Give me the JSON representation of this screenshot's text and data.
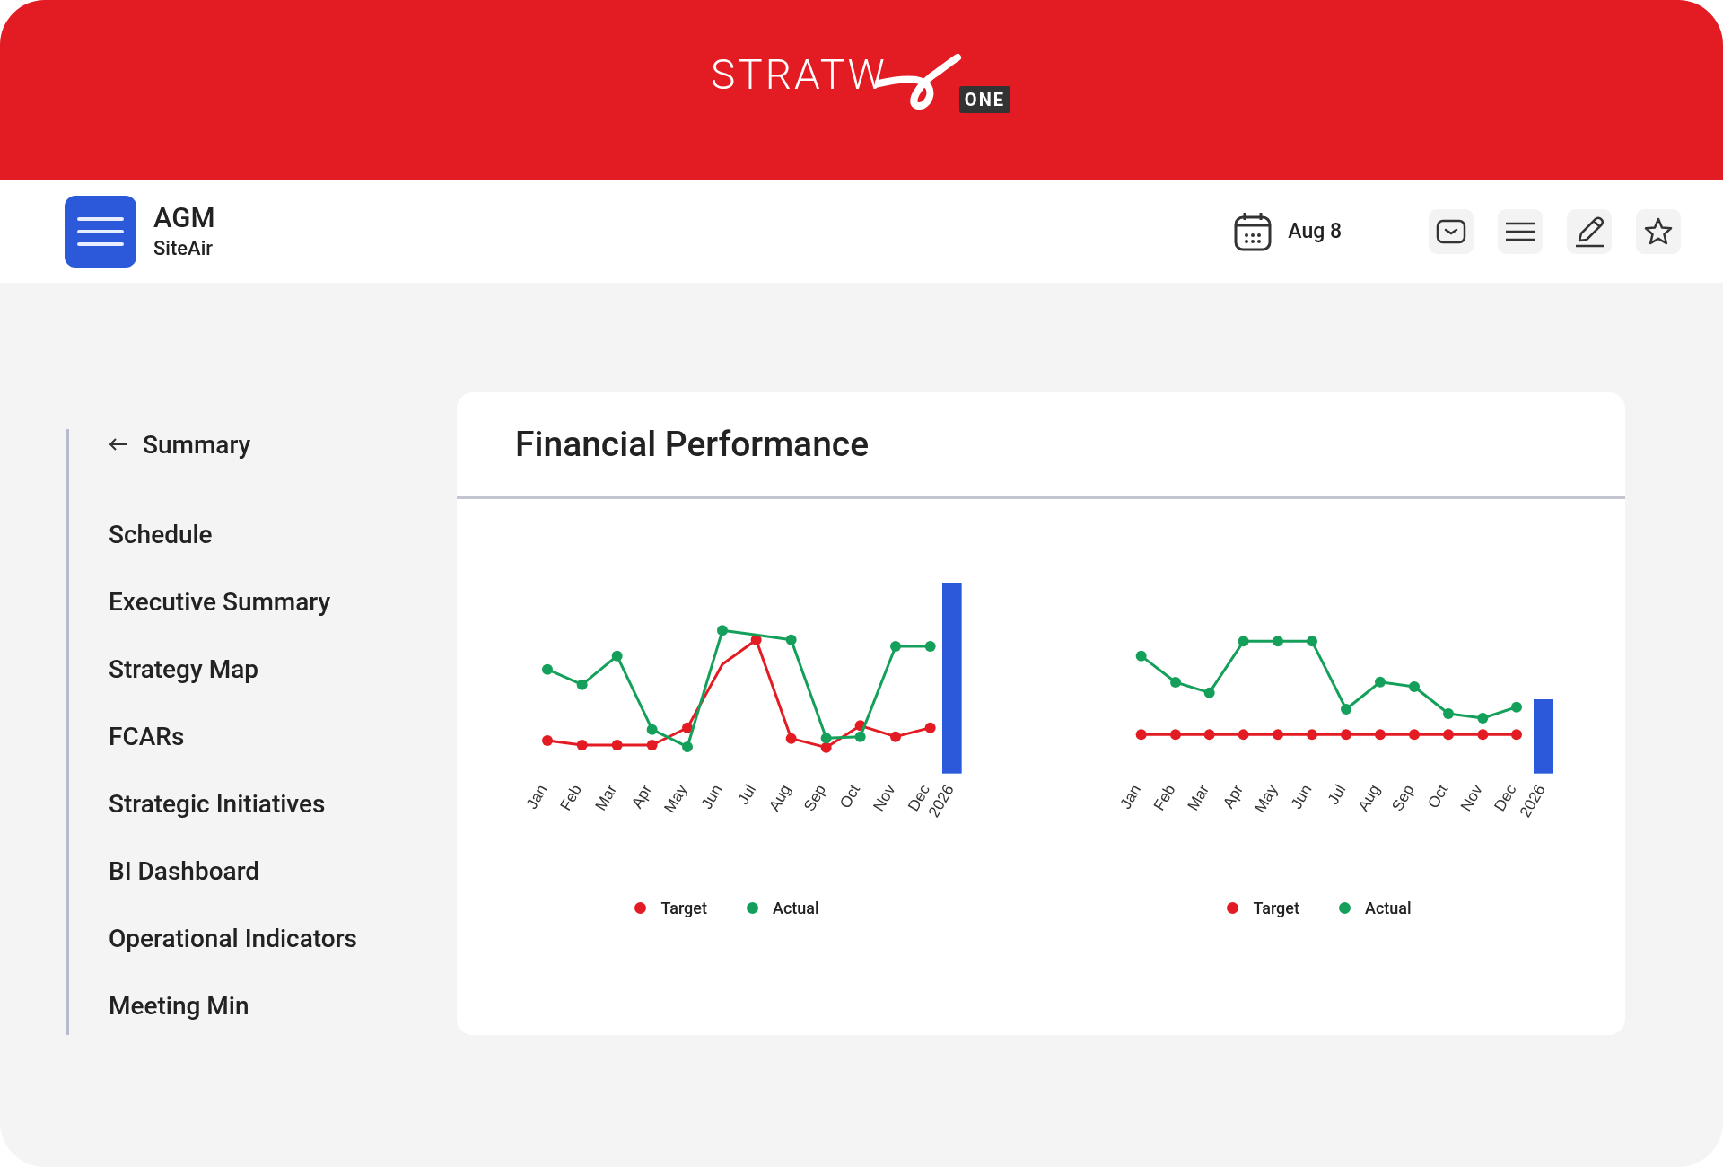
{
  "logo": {
    "wordmark": "STRATW",
    "badge": "ONE"
  },
  "topbar": {
    "title": "AGM",
    "subtitle": "SiteAir",
    "date": "Aug 8"
  },
  "sidebar": {
    "back_label": "Summary",
    "items": [
      {
        "label": "Schedule"
      },
      {
        "label": "Executive Summary"
      },
      {
        "label": "Strategy Map"
      },
      {
        "label": "FCARs"
      },
      {
        "label": "Strategic Initiatives"
      },
      {
        "label": "BI Dashboard"
      },
      {
        "label": "Operational Indicators"
      },
      {
        "label": "Meeting Min"
      }
    ]
  },
  "card": {
    "title": "Financial Performance",
    "charts": [
      {
        "categories": [
          "Jan",
          "Feb",
          "Mar",
          "Apr",
          "May",
          "Jun",
          "Jul",
          "Aug",
          "Sep",
          "Oct",
          "Nov",
          "Dec",
          "2026"
        ],
        "legend": [
          {
            "label": "Target",
            "color": "#e31b23"
          },
          {
            "label": "Actual",
            "color": "#14a05a"
          }
        ]
      },
      {
        "categories": [
          "Jan",
          "Feb",
          "Mar",
          "Apr",
          "May",
          "Jun",
          "Jul",
          "Aug",
          "Sep",
          "Oct",
          "Nov",
          "Dec",
          "2026"
        ],
        "legend": [
          {
            "label": "Target",
            "color": "#e31b23"
          },
          {
            "label": "Actual",
            "color": "#14a05a"
          }
        ]
      }
    ]
  }
}
